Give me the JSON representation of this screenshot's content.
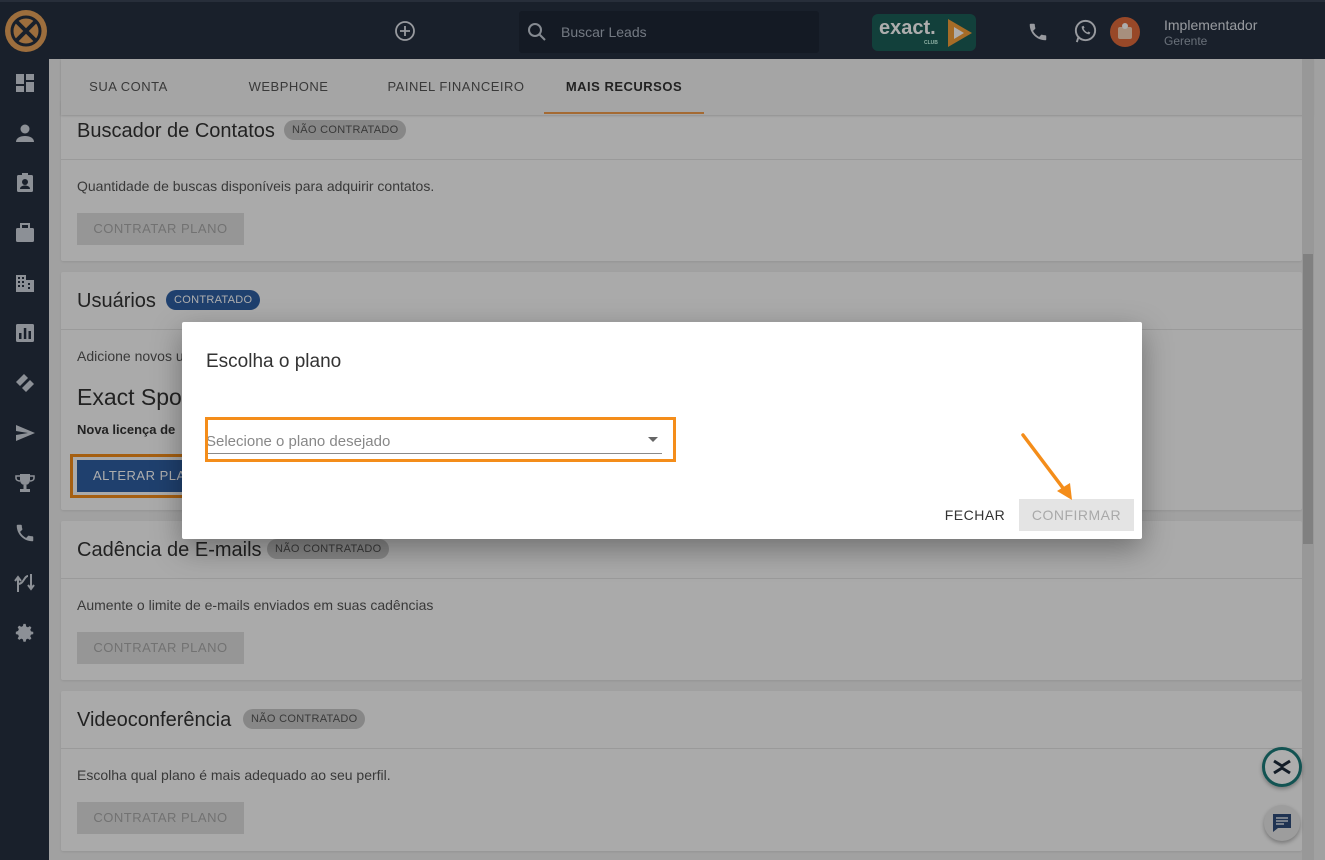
{
  "topbar": {
    "search_placeholder": "Buscar Leads",
    "brand_logo_text": "exact.",
    "brand_logo_sub": "CLUB",
    "user_name": "Implementador",
    "user_role": "Gerente"
  },
  "sidebar": {
    "items": [
      "dashboard-icon",
      "person-icon",
      "contact-card-icon",
      "briefcase-icon",
      "building-icon",
      "chart-icon",
      "tags-icon",
      "send-icon",
      "trophy-icon",
      "phone-icon",
      "flow-icon",
      "gear-icon"
    ]
  },
  "tabs": [
    {
      "label": "SUA CONTA"
    },
    {
      "label": "WEBPHONE"
    },
    {
      "label": "PAINEL FINANCEIRO"
    },
    {
      "label": "MAIS RECURSOS",
      "active": true
    }
  ],
  "cards": [
    {
      "title": "Buscador de Contatos",
      "badge": "NÃO CONTRATADO",
      "description": "Quantidade de buscas disponíveis para adquirir contatos.",
      "button": "CONTRATAR PLANO"
    },
    {
      "title": "Usuários",
      "badge": "CONTRATADO",
      "description": "Adicione novos u",
      "plan_name": "Exact Spo",
      "plan_sub": "Nova licença de",
      "button": "ALTERAR PLA"
    },
    {
      "title": "Cadência de E-mails",
      "badge": "NÃO CONTRATADO",
      "description": "Aumente o limite de e-mails enviados em suas cadências",
      "button": "CONTRATAR PLANO"
    },
    {
      "title": "Videoconferência",
      "badge": "NÃO CONTRATADO",
      "description": "Escolha qual plano é mais adequado ao seu perfil.",
      "button": "CONTRATAR PLANO"
    }
  ],
  "dialog": {
    "title": "Escolha o plano",
    "select_placeholder": "Selecione o plano desejado",
    "close_label": "FECHAR",
    "confirm_label": "CONFIRMAR"
  },
  "colors": {
    "topbar_bg": "#263040",
    "accent_orange": "#f48d1a",
    "contracted_blue": "#2e5fa3"
  }
}
